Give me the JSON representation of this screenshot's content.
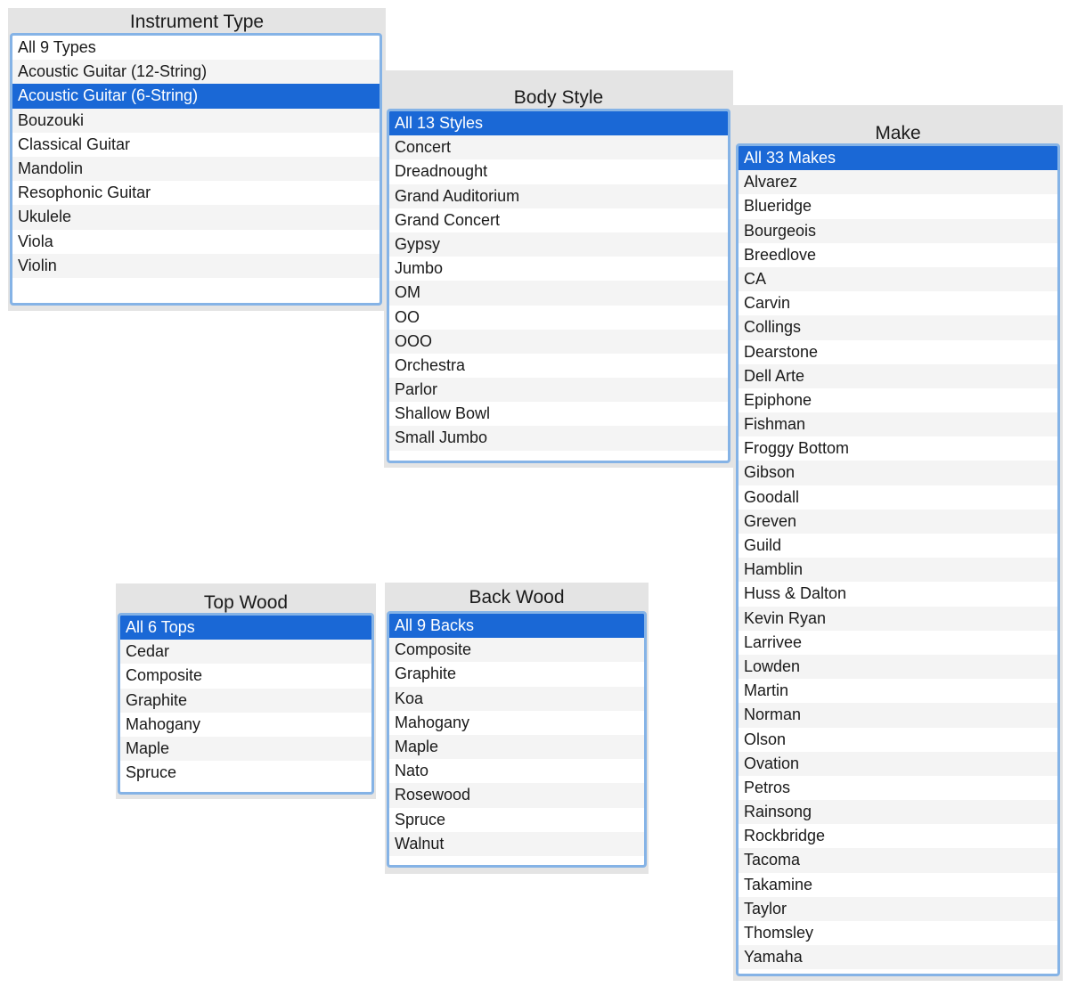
{
  "colors": {
    "panel_bg": "#e4e4e4",
    "selection": "#1a68d6",
    "focus_ring": "#85b3e6",
    "stripe": "#f4f4f4"
  },
  "instrument_type": {
    "title": "Instrument Type",
    "items": [
      "All 9 Types",
      "Acoustic Guitar (12-String)",
      "Acoustic Guitar (6-String)",
      "Bouzouki",
      "Classical Guitar",
      "Mandolin",
      "Resophonic Guitar",
      "Ukulele",
      "Viola",
      "Violin"
    ],
    "selected": "Acoustic Guitar (6-String)"
  },
  "body_style": {
    "title": "Body Style",
    "items": [
      "All 13 Styles",
      "Concert",
      "Dreadnought",
      "Grand Auditorium",
      "Grand Concert",
      "Gypsy",
      "Jumbo",
      "OM",
      "OO",
      "OOO",
      "Orchestra",
      "Parlor",
      "Shallow Bowl",
      "Small Jumbo"
    ],
    "selected": "All 13 Styles"
  },
  "make": {
    "title": "Make",
    "items": [
      "All 33 Makes",
      "Alvarez",
      "Blueridge",
      "Bourgeois",
      "Breedlove",
      "CA",
      "Carvin",
      "Collings",
      "Dearstone",
      "Dell Arte",
      "Epiphone",
      "Fishman",
      "Froggy Bottom",
      "Gibson",
      "Goodall",
      "Greven",
      "Guild",
      "Hamblin",
      "Huss & Dalton",
      "Kevin Ryan",
      "Larrivee",
      "Lowden",
      "Martin",
      "Norman",
      "Olson",
      "Ovation",
      "Petros",
      "Rainsong",
      "Rockbridge",
      "Tacoma",
      "Takamine",
      "Taylor",
      "Thomsley",
      "Yamaha"
    ],
    "selected": "All 33 Makes"
  },
  "top_wood": {
    "title": "Top Wood",
    "items": [
      "All 6 Tops",
      "Cedar",
      "Composite",
      "Graphite",
      "Mahogany",
      "Maple",
      "Spruce"
    ],
    "selected": "All 6 Tops"
  },
  "back_wood": {
    "title": "Back Wood",
    "items": [
      "All 9 Backs",
      "Composite",
      "Graphite",
      "Koa",
      "Mahogany",
      "Maple",
      "Nato",
      "Rosewood",
      "Spruce",
      "Walnut"
    ],
    "selected": "All 9 Backs"
  }
}
